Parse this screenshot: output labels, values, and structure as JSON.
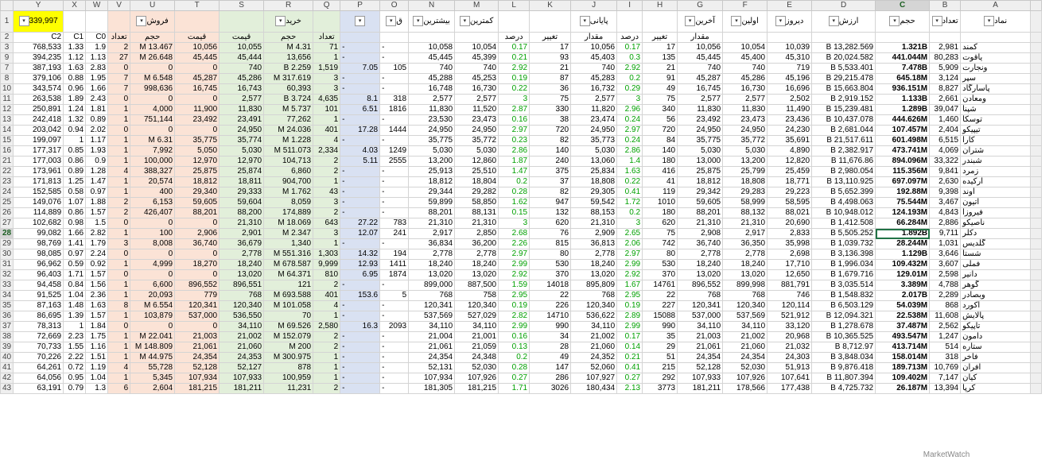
{
  "columns": [
    "Y",
    "X",
    "W",
    "V",
    "U",
    "T",
    "S",
    "R",
    "Q",
    "P",
    "O",
    "N",
    "M",
    "L",
    "K",
    "J",
    "I",
    "H",
    "G",
    "F",
    "E",
    "D",
    "C",
    "B",
    "A"
  ],
  "selected_column": "C",
  "selected_row": "28",
  "header_row1": [
    "339,997",
    "",
    "",
    "",
    "فروش",
    "",
    "",
    "خرید",
    "",
    "",
    "ق",
    "بیشترین",
    "کمترین",
    "",
    "",
    "پایانی",
    "",
    "",
    "آخرین",
    "اولین",
    "دیروز",
    "ارزش",
    "حجم",
    "تعداد",
    "نماد"
  ],
  "header_row2": [
    "C2",
    "C1",
    "C0",
    "تعداد",
    "حجم",
    "قیمت",
    "قیمت",
    "حجم",
    "تعداد",
    "",
    "",
    "",
    "",
    "درصد",
    "تغییر",
    "مقدار",
    "درصد",
    "تغییر",
    "مقدار",
    "",
    "",
    "",
    "",
    "",
    ""
  ],
  "row_numbers": [
    "3",
    "9",
    "7",
    "8",
    "10",
    "11",
    "12",
    "13",
    "14",
    "15",
    "16",
    "21",
    "22",
    "23",
    "24",
    "25",
    "26",
    "27",
    "28",
    "29",
    "30",
    "31",
    "32",
    "33",
    "34",
    "35",
    "36",
    "37",
    "38",
    "39",
    "40",
    "41",
    "42",
    "43",
    "44",
    "45",
    "46",
    "47",
    "48",
    "49",
    "50",
    "51",
    "52"
  ],
  "rows": [
    [
      "768,533",
      "1.33",
      "1.9",
      "2",
      "M 13.467",
      "10,056",
      "10,055",
      "M 4.31",
      "71",
      "-",
      "-",
      "10,058",
      "10,054",
      "0.17",
      "17",
      "10,056",
      "0.17",
      "17",
      "10,056",
      "10,054",
      "10,039",
      "B 13,282.569",
      "1.321B",
      "2,981",
      "کمند"
    ],
    [
      "394,235",
      "1.12",
      "1.13",
      "27",
      "M 26.648",
      "45,445",
      "45,444",
      "13,656",
      "1",
      "-",
      "-",
      "45,445",
      "45,399",
      "0.21",
      "93",
      "45,403",
      "0.3",
      "135",
      "45,445",
      "45,400",
      "45,310",
      "B 20,024.582",
      "441.044M",
      "80,283",
      "یاقوت"
    ],
    [
      "387,193",
      "1.63",
      "2.83",
      "0",
      "0",
      "0",
      "740",
      "B 2.259",
      "1,519",
      "7.05",
      "105",
      "740",
      "740",
      "2.92",
      "21",
      "740",
      "2.92",
      "21",
      "740",
      "740",
      "719",
      "B 5,533.401",
      "7.478B",
      "5,909",
      "ونجارت"
    ],
    [
      "379,106",
      "0.88",
      "1.95",
      "7",
      "M 6.548",
      "45,287",
      "45,286",
      "M 317.619",
      "3",
      "-",
      "-",
      "45,288",
      "45,253",
      "0.19",
      "87",
      "45,283",
      "0.2",
      "91",
      "45,287",
      "45,286",
      "45,196",
      "B 29,215.478",
      "645.18M",
      "3,124",
      "سپر"
    ],
    [
      "343,574",
      "0.96",
      "1.66",
      "7",
      "998,636",
      "16,745",
      "16,743",
      "60,393",
      "3",
      "-",
      "-",
      "16,748",
      "16,730",
      "0.22",
      "36",
      "16,732",
      "0.29",
      "49",
      "16,745",
      "16,730",
      "16,696",
      "B 15,663.804",
      "936.151M",
      "8,827",
      "پاسارگاد"
    ],
    [
      "263,538",
      "1.89",
      "2.43",
      "0",
      "0",
      "0",
      "2,577",
      "B 3.724",
      "4,635",
      "8.1",
      "318",
      "2,577",
      "2,577",
      "3",
      "75",
      "2,577",
      "3",
      "75",
      "2,577",
      "2,577",
      "2,502",
      "B 2,919.152",
      "1.133B",
      "2,661",
      "ومعادن"
    ],
    [
      "250,891",
      "1.24",
      "1.81",
      "1",
      "4,000",
      "11,900",
      "11,830",
      "M 5.737",
      "101",
      "6.51",
      "1816",
      "11,830",
      "11,520",
      "2.87",
      "330",
      "11,820",
      "2.96",
      "340",
      "11,830",
      "11,830",
      "11,490",
      "B 15,239.481",
      "1.289B",
      "39,047",
      "شپنا"
    ],
    [
      "242,418",
      "1.32",
      "0.89",
      "1",
      "751,144",
      "23,492",
      "23,491",
      "77,262",
      "1",
      "-",
      "-",
      "23,530",
      "23,473",
      "0.16",
      "38",
      "23,474",
      "0.24",
      "56",
      "23,492",
      "23,473",
      "23,436",
      "B 10,437.078",
      "444.626M",
      "1,460",
      "توسکا"
    ],
    [
      "203,042",
      "0.94",
      "2.02",
      "0",
      "0",
      "0",
      "24,950",
      "M 24.036",
      "401",
      "17.28",
      "1444",
      "24,950",
      "24,950",
      "2.97",
      "720",
      "24,950",
      "2.97",
      "720",
      "24,950",
      "24,950",
      "24,230",
      "B 2,681.044",
      "107.457M",
      "2,404",
      "تیپیکو"
    ],
    [
      "199,097",
      "1",
      "1.17",
      "1",
      "M 6.31",
      "35,775",
      "35,774",
      "M 1.228",
      "4",
      "-",
      "-",
      "35,775",
      "35,772",
      "0.23",
      "82",
      "35,773",
      "0.24",
      "84",
      "35,775",
      "35,772",
      "35,691",
      "B 21,517.611",
      "601.498M",
      "6,515",
      "کارا"
    ],
    [
      "177,317",
      "0.85",
      "1.93",
      "1",
      "7,992",
      "5,050",
      "5,030",
      "M 511.073",
      "2,334",
      "4.03",
      "1249",
      "5,030",
      "5,030",
      "2.86",
      "140",
      "5,030",
      "2.86",
      "140",
      "5,030",
      "5,030",
      "4,890",
      "B 2,382.917",
      "473.741M",
      "4,069",
      "شتران"
    ],
    [
      "177,003",
      "0.86",
      "0.9",
      "1",
      "100,000",
      "12,970",
      "12,970",
      "104,713",
      "2",
      "5.11",
      "2555",
      "13,200",
      "12,860",
      "1.87",
      "240",
      "13,060",
      "1.4",
      "180",
      "13,000",
      "13,200",
      "12,820",
      "B 11,676.86",
      "894.096M",
      "33,322",
      "شبندر"
    ],
    [
      "173,961",
      "0.89",
      "1.28",
      "4",
      "388,327",
      "25,875",
      "25,874",
      "6,860",
      "2",
      "-",
      "-",
      "25,913",
      "25,510",
      "1.47",
      "375",
      "25,834",
      "1.63",
      "416",
      "25,875",
      "25,799",
      "25,459",
      "B 2,980.054",
      "115.356M",
      "9,841",
      "زمرد"
    ],
    [
      "171,813",
      "1.25",
      "1.47",
      "1",
      "20,574",
      "18,812",
      "18,811",
      "904,700",
      "1",
      "-",
      "-",
      "18,812",
      "18,804",
      "0.2",
      "37",
      "18,808",
      "0.22",
      "41",
      "18,812",
      "18,808",
      "18,771",
      "B 13,110.925",
      "697.097M",
      "2,630",
      "ارکیده"
    ],
    [
      "152,585",
      "0.58",
      "0.97",
      "1",
      "400",
      "29,340",
      "29,333",
      "M 1.762",
      "43",
      "-",
      "-",
      "29,344",
      "29,282",
      "0.28",
      "82",
      "29,305",
      "0.41",
      "119",
      "29,342",
      "29,283",
      "29,223",
      "B 5,652.399",
      "192.88M",
      "9,398",
      "آوند"
    ],
    [
      "149,076",
      "1.07",
      "1.88",
      "2",
      "6,153",
      "59,605",
      "59,604",
      "8,059",
      "3",
      "-",
      "-",
      "59,899",
      "58,850",
      "1.62",
      "947",
      "59,542",
      "1.72",
      "1010",
      "59,605",
      "58,999",
      "58,595",
      "B 4,498.063",
      "75.544M",
      "3,467",
      "اتیون"
    ],
    [
      "114,889",
      "0.86",
      "1.57",
      "2",
      "426,407",
      "88,201",
      "88,200",
      "174,889",
      "2",
      "-",
      "-",
      "88,201",
      "88,131",
      "0.15",
      "132",
      "88,153",
      "0.2",
      "180",
      "88,201",
      "88,132",
      "88,021",
      "B 10,948.012",
      "124.193M",
      "4,843",
      "فیروزا"
    ],
    [
      "102,682",
      "0.98",
      "1.5",
      "0",
      "0",
      "0",
      "21,310",
      "M 18.069",
      "643",
      "27.22",
      "783",
      "21,310",
      "21,310",
      "3",
      "620",
      "21,310",
      "3",
      "620",
      "21,310",
      "21,310",
      "20,690",
      "B 1,412.508",
      "66.284M",
      "2,886",
      "ناصیکو"
    ],
    [
      "99,082",
      "1.66",
      "2.82",
      "1",
      "100",
      "2,906",
      "2,901",
      "M 2.347",
      "3",
      "12.07",
      "241",
      "2,917",
      "2,850",
      "2.68",
      "76",
      "2,909",
      "2.65",
      "75",
      "2,908",
      "2,917",
      "2,833",
      "B 5,505.252",
      "1.892B",
      "9,711",
      "دکلر"
    ],
    [
      "98,769",
      "1.41",
      "1.79",
      "3",
      "8,008",
      "36,740",
      "36,679",
      "1,340",
      "1",
      "-",
      "-",
      "36,834",
      "36,200",
      "2.26",
      "815",
      "36,813",
      "2.06",
      "742",
      "36,740",
      "36,350",
      "35,998",
      "B 1,039.732",
      "28.244M",
      "1,031",
      "گلدیس"
    ],
    [
      "98,085",
      "0.97",
      "2.24",
      "0",
      "0",
      "0",
      "2,778",
      "M 551.316",
      "1,303",
      "14.32",
      "194",
      "2,778",
      "2,778",
      "2.97",
      "80",
      "2,778",
      "2.97",
      "80",
      "2,778",
      "2,778",
      "2,698",
      "B 3,136.398",
      "1.129B",
      "3,646",
      "شستا"
    ],
    [
      "96,962",
      "0.59",
      "0.92",
      "1",
      "4,999",
      "18,270",
      "18,240",
      "M 678.587",
      "9,999",
      "12.93",
      "1411",
      "18,240",
      "18,240",
      "2.99",
      "530",
      "18,240",
      "2.99",
      "530",
      "18,240",
      "18,240",
      "17,710",
      "B 1,996.034",
      "109.432M",
      "3,607",
      "فملی"
    ],
    [
      "96,403",
      "1.71",
      "1.57",
      "0",
      "0",
      "0",
      "13,020",
      "M 64.371",
      "810",
      "6.95",
      "1874",
      "13,020",
      "13,020",
      "2.92",
      "370",
      "13,020",
      "2.92",
      "370",
      "13,020",
      "13,020",
      "12,650",
      "B 1,679.716",
      "129.01M",
      "2,598",
      "دانیر"
    ],
    [
      "94,458",
      "0.84",
      "1.56",
      "1",
      "6,600",
      "896,552",
      "896,551",
      "121",
      "2",
      "-",
      "-",
      "899,000",
      "887,500",
      "1.59",
      "14018",
      "895,809",
      "1.67",
      "14761",
      "896,552",
      "899,998",
      "881,791",
      "B 3,035.514",
      "3.389M",
      "4,788",
      "گوهر"
    ],
    [
      "91,525",
      "1.04",
      "2.36",
      "1",
      "20,093",
      "779",
      "768",
      "M 693.588",
      "401",
      "153.6",
      "5",
      "768",
      "758",
      "2.95",
      "22",
      "768",
      "2.95",
      "22",
      "768",
      "768",
      "746",
      "B 1,548.832",
      "2.017B",
      "2,289",
      "وبصادر"
    ],
    [
      "87,163",
      "1.48",
      "1.63",
      "8",
      "M 6.554",
      "120,341",
      "120,340",
      "M 101.058",
      "4",
      "-",
      "-",
      "120,341",
      "120,340",
      "0.19",
      "226",
      "120,340",
      "0.19",
      "227",
      "120,341",
      "120,340",
      "120,114",
      "B 6,503.129",
      "54.039M",
      "868",
      "آکورد"
    ],
    [
      "86,695",
      "1.39",
      "1.57",
      "1",
      "103,879",
      "537,000",
      "536,550",
      "70",
      "1",
      "-",
      "-",
      "537,569",
      "527,029",
      "2.82",
      "14710",
      "536,622",
      "2.89",
      "15088",
      "537,000",
      "537,569",
      "521,912",
      "B 12,094.321",
      "22.538M",
      "11,608",
      "پالایش"
    ],
    [
      "78,313",
      "1",
      "1.84",
      "0",
      "0",
      "0",
      "34,110",
      "M 69.526",
      "2,580",
      "16.3",
      "2093",
      "34,110",
      "34,110",
      "2.99",
      "990",
      "34,110",
      "2.99",
      "990",
      "34,110",
      "34,110",
      "33,120",
      "B 1,278.678",
      "37.487M",
      "2,562",
      "تاپیکو"
    ],
    [
      "72,669",
      "2.23",
      "1.75",
      "1",
      "M 22.041",
      "21,003",
      "21,002",
      "M 152.079",
      "2",
      "-",
      "-",
      "21,004",
      "21,001",
      "0.16",
      "34",
      "21,002",
      "0.17",
      "35",
      "21,003",
      "21,002",
      "20,968",
      "B 10,365.525",
      "493.547M",
      "1,247",
      "دامون"
    ],
    [
      "70,733",
      "1.55",
      "1.16",
      "1",
      "M 148.809",
      "21,061",
      "21,060",
      "M 200",
      "2",
      "-",
      "-",
      "21,061",
      "21,059",
      "0.13",
      "28",
      "21,060",
      "0.14",
      "29",
      "21,061",
      "21,060",
      "21,032",
      "B 8,712.97",
      "413.714M",
      "514",
      "ستاره"
    ],
    [
      "70,226",
      "2.22",
      "1.51",
      "1",
      "M 44.975",
      "24,354",
      "24,353",
      "M 300.975",
      "1",
      "-",
      "-",
      "24,354",
      "24,348",
      "0.2",
      "49",
      "24,352",
      "0.21",
      "51",
      "24,354",
      "24,354",
      "24,303",
      "B 3,848.034",
      "158.014M",
      "318",
      "فاخر"
    ],
    [
      "64,261",
      "0.72",
      "1.19",
      "4",
      "55,728",
      "52,128",
      "52,127",
      "878",
      "1",
      "-",
      "-",
      "52,131",
      "52,030",
      "0.28",
      "147",
      "52,060",
      "0.41",
      "215",
      "52,128",
      "52,030",
      "51,913",
      "B 9,876.418",
      "189.713M",
      "10,769",
      "افران"
    ],
    [
      "64,056",
      "0.95",
      "1.04",
      "1",
      "5,345",
      "107,934",
      "107,933",
      "100,959",
      "1",
      "-",
      "-",
      "107,934",
      "107,926",
      "0.27",
      "286",
      "107,927",
      "0.27",
      "292",
      "107,933",
      "107,926",
      "107,641",
      "B 11,807.394",
      "109.402M",
      "7,147",
      "کیان"
    ],
    [
      "63,191",
      "0.79",
      "1.3",
      "6",
      "2,604",
      "181,215",
      "181,211",
      "11,231",
      "2",
      "-",
      "-",
      "181,305",
      "181,215",
      "1.71",
      "3026",
      "180,434",
      "2.13",
      "3773",
      "181,211",
      "178,566",
      "177,438",
      "B 4,725.732",
      "26.187M",
      "13,394",
      "کرپا"
    ]
  ],
  "green_cols": [
    13,
    16
  ],
  "bold_col": 22,
  "tab_label": "MarketWatch"
}
